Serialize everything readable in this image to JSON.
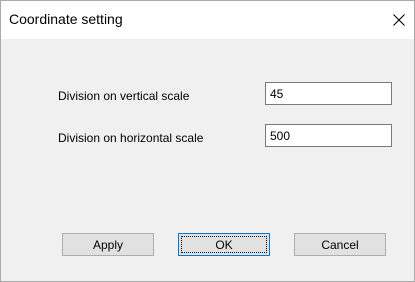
{
  "window": {
    "title": "Coordinate setting",
    "close_icon": "close-icon"
  },
  "form": {
    "vertical_label": "Division on vertical scale",
    "vertical_value": "45",
    "horizontal_label": "Division on horizontal scale",
    "horizontal_value": "500"
  },
  "buttons": {
    "apply_label": "Apply",
    "ok_label": "OK",
    "cancel_label": "Cancel"
  },
  "colors": {
    "accent": "#0078d7",
    "dialog_bg": "#f0f0f0",
    "button_bg": "#e1e1e1"
  }
}
